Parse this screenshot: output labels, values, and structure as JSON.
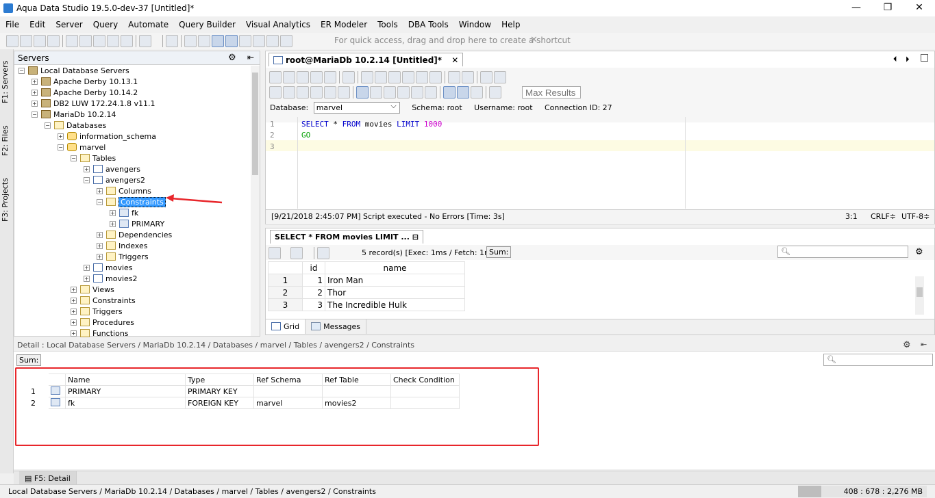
{
  "window": {
    "title": "Aqua Data Studio 19.5.0-dev-37 [Untitled]*",
    "minimize": "—",
    "restore": "❐",
    "close": "✕"
  },
  "menu": [
    "File",
    "Edit",
    "Server",
    "Query",
    "Automate",
    "Query Builder",
    "Visual Analytics",
    "ER Modeler",
    "Tools",
    "DBA Tools",
    "Window",
    "Help"
  ],
  "toolbar": {
    "quick_access": "For quick access, drag and drop here to create a shortcut"
  },
  "left_strip": {
    "servers_tab": "F1: Servers",
    "files_tab": "F2: Files",
    "projects_tab": "F3: Projects"
  },
  "servers_panel": {
    "title": "Servers",
    "tree": [
      {
        "label": "Local Database Servers",
        "icon": "servers",
        "expander": "−"
      },
      {
        "label": "Apache Derby 10.13.1",
        "icon": "srv",
        "expander": "+"
      },
      {
        "label": "Apache Derby 10.14.2",
        "icon": "srv",
        "expander": "+"
      },
      {
        "label": "DB2 LUW 172.24.1.8 v11.1",
        "icon": "srv",
        "expander": "+"
      },
      {
        "label": "MariaDb 10.2.14",
        "icon": "srv",
        "expander": "−"
      },
      {
        "label": "Databases",
        "icon": "fold",
        "expander": "−"
      },
      {
        "label": "information_schema",
        "icon": "db",
        "expander": "+"
      },
      {
        "label": "marvel",
        "icon": "db",
        "expander": "−"
      },
      {
        "label": "Tables",
        "icon": "fold",
        "expander": "−"
      },
      {
        "label": "avengers",
        "icon": "tbl",
        "expander": "+"
      },
      {
        "label": "avengers2",
        "icon": "tbl",
        "expander": "−"
      },
      {
        "label": "Columns",
        "icon": "fold",
        "expander": "+"
      },
      {
        "label": "Constraints",
        "icon": "fold",
        "expander": "−"
      },
      {
        "label": "fk",
        "icon": "key",
        "expander": "+"
      },
      {
        "label": "PRIMARY",
        "icon": "key",
        "expander": "+"
      },
      {
        "label": "Dependencies",
        "icon": "fold",
        "expander": "+"
      },
      {
        "label": "Indexes",
        "icon": "fold",
        "expander": "+"
      },
      {
        "label": "Triggers",
        "icon": "fold",
        "expander": "+"
      },
      {
        "label": "movies",
        "icon": "tbl",
        "expander": "+"
      },
      {
        "label": "movies2",
        "icon": "tbl",
        "expander": "+"
      },
      {
        "label": "Views",
        "icon": "fold",
        "expander": "+"
      },
      {
        "label": "Constraints",
        "icon": "fold",
        "expander": "+"
      },
      {
        "label": "Triggers",
        "icon": "fold",
        "expander": "+"
      },
      {
        "label": "Procedures",
        "icon": "fold",
        "expander": "+"
      },
      {
        "label": "Functions",
        "icon": "fold",
        "expander": "+"
      }
    ]
  },
  "editor": {
    "tab": "root@MariaDb 10.2.14 [Untitled]*",
    "max_results_placeholder": "Max Results",
    "database_label": "Database:",
    "database_value": "marvel",
    "schema": "Schema:  root",
    "username": "Username:  root",
    "connection": "Connection ID:  27",
    "lines": [
      "1",
      "2",
      "3"
    ],
    "code": {
      "select": "SELECT",
      "star": "*",
      "from": "FROM",
      "table": "movies",
      "limit": "LIMIT",
      "n": "1000",
      "go": "GO"
    },
    "status": "[9/21/2018 2:45:07 PM] Script executed - No Errors [Time: 3s]",
    "cursor": "3:1",
    "eol": "CRLF≑",
    "encoding": "UTF-8≑"
  },
  "results": {
    "tab": "SELECT * FROM movies LIMIT ...",
    "records": "5 record(s) [Exec: 1ms / Fetch: 1ms]",
    "sum": "Sum:",
    "headers": [
      "id",
      "name"
    ],
    "rows": [
      [
        "1",
        "1",
        "Iron Man"
      ],
      [
        "2",
        "2",
        "Thor"
      ],
      [
        "3",
        "3",
        "The Incredible Hulk"
      ]
    ],
    "grid_tab": "Grid",
    "messages_tab": "Messages"
  },
  "detail": {
    "path": "Detail : Local Database Servers / MariaDb 10.2.14 / Databases / marvel / Tables / avengers2 / Constraints",
    "sum": "Sum:",
    "headers": [
      "Name",
      "Type",
      "Ref Schema",
      "Ref Table",
      "Check Condition"
    ],
    "rows": [
      {
        "n": "1",
        "name": "PRIMARY",
        "type": "PRIMARY KEY",
        "ref_schema": "",
        "ref_table": "",
        "check": ""
      },
      {
        "n": "2",
        "name": "fk",
        "type": "FOREIGN KEY",
        "ref_schema": "marvel",
        "ref_table": "movies2",
        "check": ""
      }
    ],
    "bottom_tab": "F5: Detail"
  },
  "statusbar": {
    "path": "Local Database Servers / MariaDb 10.2.14 / Databases / marvel / Tables / avengers2 / Constraints",
    "memory": "408 : 678 : 2,276 MB"
  },
  "colors": {
    "annotation_red": "#e8262b",
    "selection_blue": "#3399ff"
  }
}
